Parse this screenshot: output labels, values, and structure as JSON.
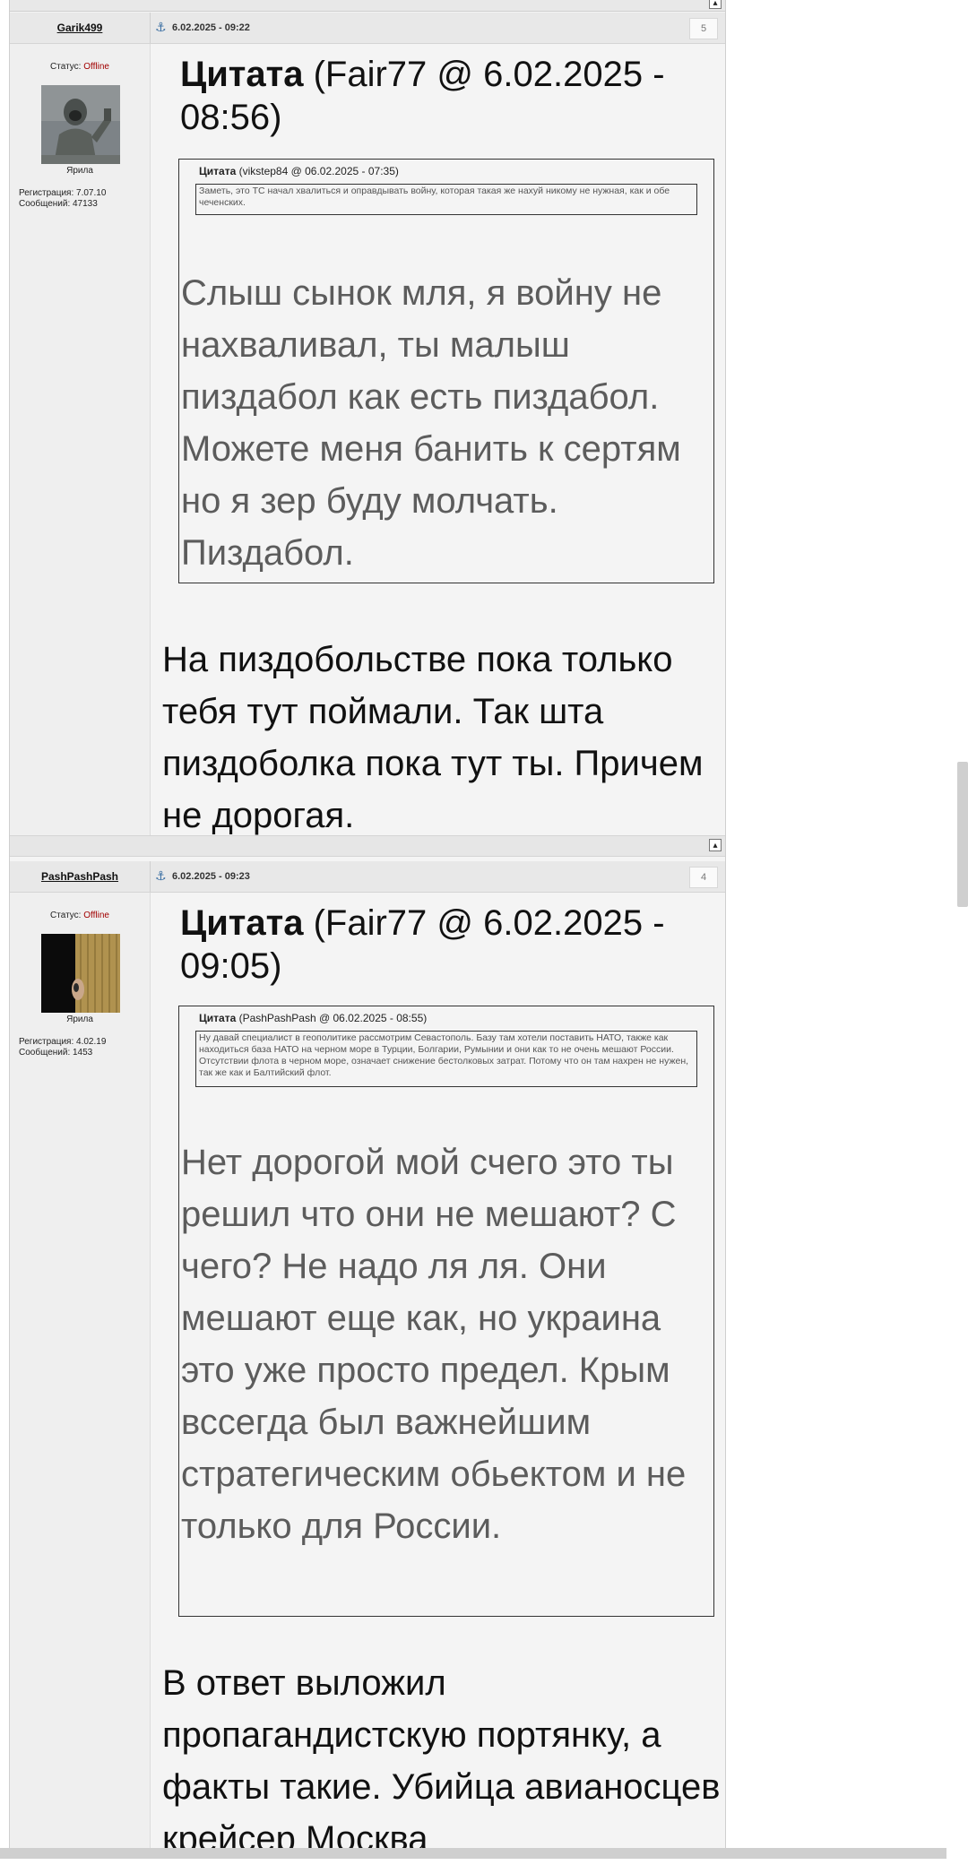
{
  "colors": {
    "offline": "#a10000",
    "quoted_text": "#5c5c5c",
    "header_bg": "#e8e8e8",
    "page_bg": "#f4f4f4"
  },
  "icons": {
    "anchor": "anchor-icon",
    "top": "scroll-top-icon",
    "avatar1": "soldier-avatar-image",
    "avatar2": "door-avatar-image"
  },
  "posts": [
    {
      "author": "Garik499",
      "status_label": "Статус: ",
      "status_value": "Offline",
      "rank": "Ярила",
      "registration": "Регистрация: 7.07.10",
      "messages": "Сообщений: 47133",
      "date": "6.02.2025 - 09:22",
      "number": "5",
      "quote_word": "Цитата",
      "quote_source": " (Fair77 @ 6.02.2025 - 08:56)",
      "nested_word": "Цитата",
      "nested_source": " (vikstep84 @ 06.02.2025 - 07:35)",
      "nested_text": "Заметь, это ТС начал хвалиться и оправдывать войну, которая такая же нахуй никому не нужная, как и обе чеченских.",
      "quoted_text": "Слыш сынок мля, я войну не нахваливал, ты малыш пиздабол как есть пиздабол. Можете меня банить к сертям но я зер буду молчать. Пиздабол.",
      "reply": "На пиздобольстве пока только тебя тут поймали. Так шта пиздоболка пока тут ты. Причем не дорогая."
    },
    {
      "author": "PashPashPash",
      "status_label": "Статус: ",
      "status_value": "Offline",
      "rank": "Ярила",
      "registration": "Регистрация: 4.02.19",
      "messages": "Сообщений: 1453",
      "date": "6.02.2025 - 09:23",
      "number": "4",
      "quote_word": "Цитата",
      "quote_source": " (Fair77 @ 6.02.2025 - 09:05)",
      "nested_word": "Цитата",
      "nested_source": " (PashPashPash @ 06.02.2025 - 08:55)",
      "nested_text": "Ну давай специалист в геополитике рассмотрим Севастополь. Базу там хотели поставить НАТО, также как находиться база НАТО на черном море в Турции, Болгарии, Румынии и они как то не очень мешают России. Отсутствии флота в черном море, означает снижение бестолковых затрат. Потому что он там нахрен не нужен, так же как и Балтийский флот.",
      "quoted_text": "Нет дорогой мой счего это ты решил что они не мешают? С чего? Не надо ля ля. Они мешают еще как, но украина это уже просто предел. Крым вссегда был важнейшим стратегическим обьектом и не только для России.",
      "reply": "В ответ выложил пропагандистскую портянку, а факты такие. Убийца авианосцев крейсер Москва"
    }
  ]
}
